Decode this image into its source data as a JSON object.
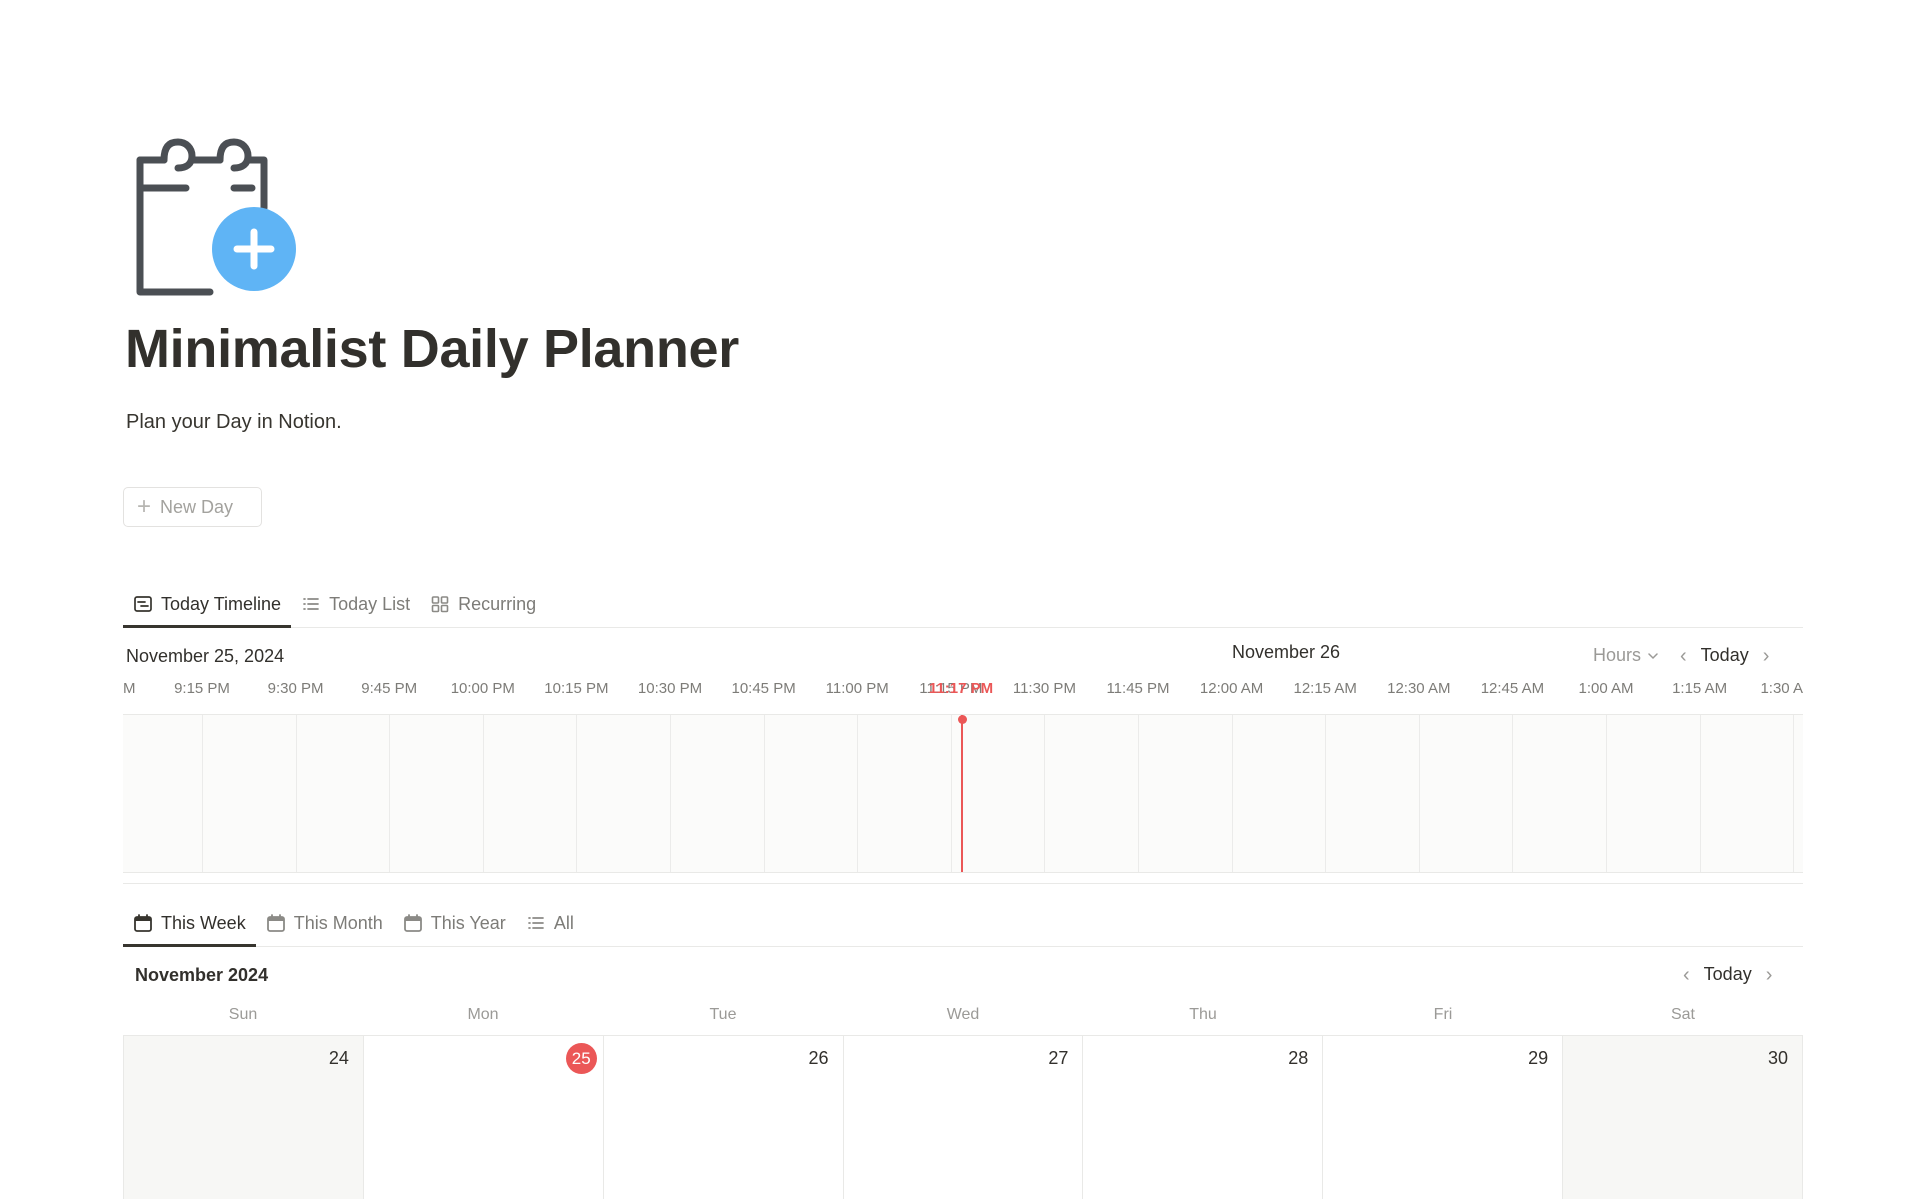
{
  "page": {
    "icon": "calendar-add-icon",
    "title": "Minimalist Daily Planner",
    "subtitle": "Plan your Day in Notion.",
    "new_button_label": "New Day"
  },
  "timeline_tabs": [
    {
      "label": "Today Timeline",
      "icon": "timeline-icon",
      "active": true
    },
    {
      "label": "Today List",
      "icon": "list-icon",
      "active": false
    },
    {
      "label": "Recurring",
      "icon": "gallery-icon",
      "active": false
    }
  ],
  "timeline": {
    "date": "November 25, 2024",
    "next_date": "November 26",
    "zoom": "Hours",
    "today_label": "Today",
    "first_label_fragment": "M",
    "last_label_fragment": "1:30 A",
    "times": [
      "9:15 PM",
      "9:30 PM",
      "9:45 PM",
      "10:00 PM",
      "10:15 PM",
      "10:30 PM",
      "10:45 PM",
      "11:00 PM",
      "11:15 PM",
      "11:30 PM",
      "11:45 PM",
      "12:00 AM",
      "12:15 AM",
      "12:30 AM",
      "12:45 AM",
      "1:00 AM",
      "1:15 AM"
    ],
    "now_label": "11:17 PM"
  },
  "view_tabs": [
    {
      "label": "This Week",
      "icon": "calendar-icon",
      "active": true
    },
    {
      "label": "This Month",
      "icon": "calendar-icon",
      "active": false
    },
    {
      "label": "This Year",
      "icon": "calendar-icon",
      "active": false
    },
    {
      "label": "All",
      "icon": "list-icon",
      "active": false
    }
  ],
  "calendar": {
    "month": "November 2024",
    "today_label": "Today",
    "weekdays": [
      "Sun",
      "Mon",
      "Tue",
      "Wed",
      "Thu",
      "Fri",
      "Sat"
    ],
    "days": [
      "24",
      "25",
      "26",
      "27",
      "28",
      "29",
      "30"
    ],
    "today_index": 1,
    "colors": {
      "today": "#eb5757",
      "weekend_bg": "#f7f7f5"
    }
  }
}
